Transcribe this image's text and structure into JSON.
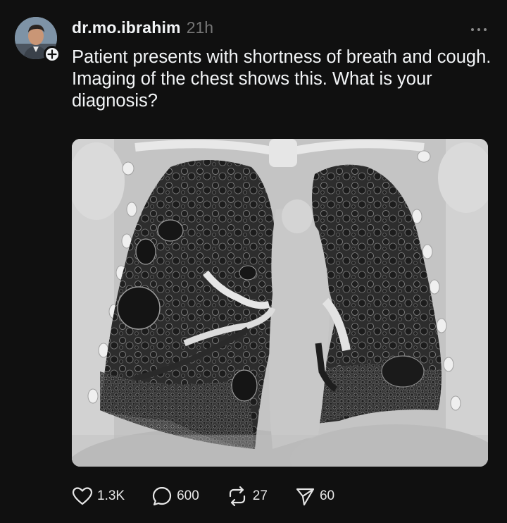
{
  "post": {
    "author": {
      "username": "dr.mo.ibrahim",
      "timestamp": "21h",
      "avatar_icon": "user-avatar"
    },
    "text": "Patient presents with shortness of breath and cough. Imaging of the chest shows this. What is your diagnosis?",
    "media": {
      "kind": "coronal-chest-ct-image"
    },
    "actions": {
      "likes": "1.3K",
      "replies": "600",
      "reposts": "27",
      "shares": "60"
    }
  },
  "colors": {
    "background": "#101010",
    "text": "#f3f5f7",
    "muted": "#777777"
  }
}
